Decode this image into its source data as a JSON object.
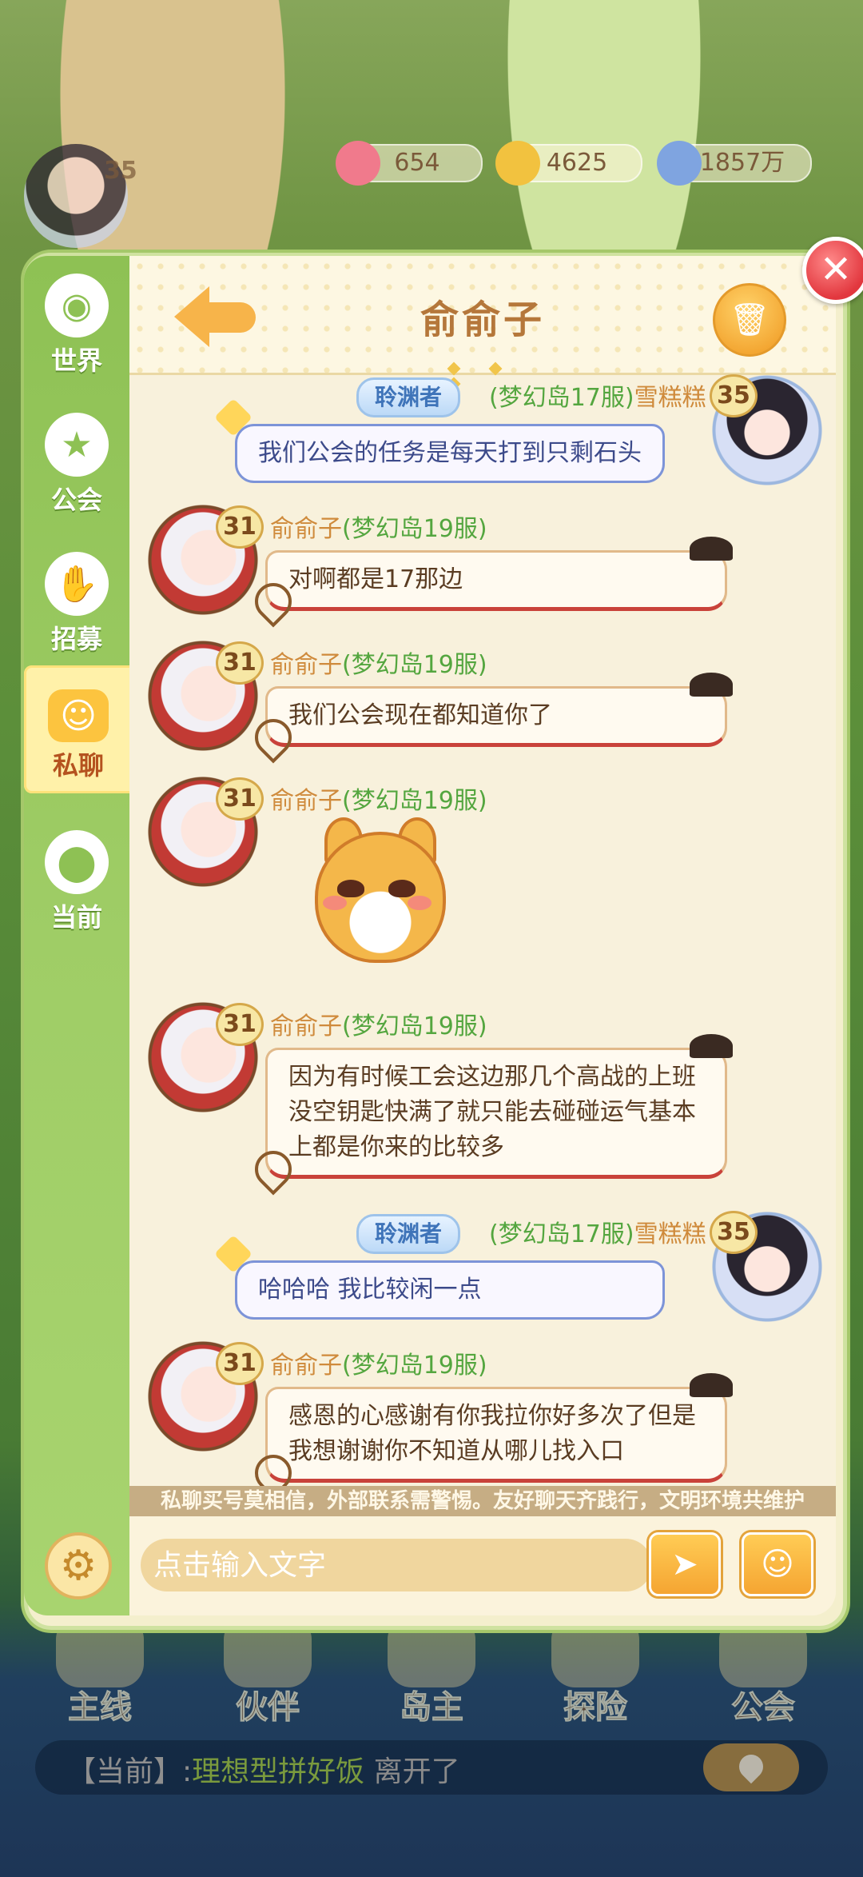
{
  "hud": {
    "player_level": "35",
    "gems": "654",
    "coins": "4625",
    "power": "1857万"
  },
  "sidebar": {
    "items": [
      {
        "label": "世界",
        "icon": "globe-icon"
      },
      {
        "label": "公会",
        "icon": "guild-flag-icon"
      },
      {
        "label": "招募",
        "icon": "handshake-icon"
      },
      {
        "label": "私聊",
        "icon": "chat-bubble-icon",
        "active": true
      },
      {
        "label": "当前",
        "icon": "location-pin-icon"
      }
    ]
  },
  "chat": {
    "title": "俞俞子",
    "messages": [
      {
        "side": "self",
        "level": "35",
        "badge": "聆渊者",
        "server": "(梦幻岛17服)",
        "name": "雪糕糕",
        "text": "我们公会的任务是每天打到只剩石头"
      },
      {
        "side": "other",
        "level": "31",
        "name": "俞俞子",
        "server": "(梦幻岛19服)",
        "text": "对啊都是17那边"
      },
      {
        "side": "other",
        "level": "31",
        "name": "俞俞子",
        "server": "(梦幻岛19服)",
        "text": "我们公会现在都知道你了"
      },
      {
        "side": "other",
        "level": "31",
        "name": "俞俞子",
        "server": "(梦幻岛19服)",
        "sticker": "shiba-sticker"
      },
      {
        "side": "other",
        "level": "31",
        "name": "俞俞子",
        "server": "(梦幻岛19服)",
        "lines": [
          "因为有时候工会这边那几个高战的上班",
          "没空钥匙快满了就只能去碰碰运气基本",
          "上都是你来的比较多"
        ]
      },
      {
        "side": "self",
        "level": "35",
        "badge": "聆渊者",
        "server": "(梦幻岛17服)",
        "name": "雪糕糕",
        "text": "哈哈哈 我比较闲一点"
      },
      {
        "side": "other",
        "level": "31",
        "name": "俞俞子",
        "server": "(梦幻岛19服)",
        "lines": [
          "感恩的心感谢有你我拉你好多次了但是",
          "我想谢谢你不知道从哪儿找入口"
        ]
      }
    ],
    "notice": "私聊买号莫相信，外部联系需警惕。友好聊天齐践行，文明环境共维护",
    "input_placeholder": "点击输入文字"
  },
  "bottom_nav": {
    "items": [
      "主线",
      "伙伴",
      "岛主",
      "探险",
      "公会"
    ]
  },
  "status_bar": {
    "prefix": "【当前】:",
    "player": "理想型拼好饭",
    "action": "离开了"
  },
  "colors": {
    "sidebar_green": "#8ec154",
    "accent_orange": "#f7b44a",
    "title_brown": "#b5773a",
    "server_green": "#54a63f",
    "close_red": "#e2373e"
  }
}
